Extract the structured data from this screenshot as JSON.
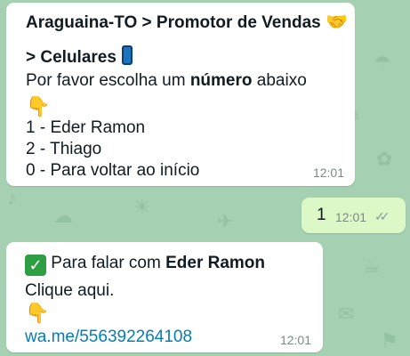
{
  "colors": {
    "wallpaper": "#a5d0b1",
    "incoming_bubble": "#ffffff",
    "outgoing_bubble": "#dcf8c6",
    "link": "#027eb5"
  },
  "messages": [
    {
      "direction": "incoming",
      "title_line1": "Araguaina-TO > Promotor de Vendas",
      "title_line2": "> Celulares",
      "prompt_prefix": "Por favor escolha um ",
      "prompt_bold": "número",
      "prompt_suffix": " abaixo",
      "options": [
        "1 - Eder Ramon",
        "2 - Thiago",
        "0 - Para voltar ao início"
      ],
      "time": "12:01",
      "icons": [
        "handshake-icon",
        "mobile-phone-icon",
        "pointing-down-icon"
      ]
    },
    {
      "direction": "outgoing",
      "text": "1",
      "time": "12:01",
      "status": "read-double-check-icon"
    },
    {
      "direction": "incoming",
      "line1_prefix": "Para falar com ",
      "line1_bold": "Eder Ramon",
      "line2": "Clique aqui.",
      "link": "wa.me/556392264108",
      "time": "12:01",
      "icons": [
        "checkmark-icon",
        "pointing-down-icon"
      ]
    }
  ]
}
